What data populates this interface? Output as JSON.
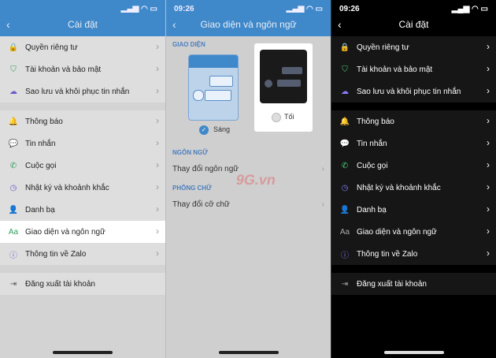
{
  "left": {
    "time": "",
    "title": "Cài đặt",
    "groups": [
      [
        {
          "label": "Quyền riêng tư",
          "icon": "lock-icon"
        },
        {
          "label": "Tài khoản và bảo mật",
          "icon": "shield-icon"
        },
        {
          "label": "Sao lưu và khôi phục tin nhắn",
          "icon": "cloud-icon"
        }
      ],
      [
        {
          "label": "Thông báo",
          "icon": "bell-icon"
        },
        {
          "label": "Tin nhắn",
          "icon": "chat-icon"
        },
        {
          "label": "Cuộc gọi",
          "icon": "phone-icon"
        },
        {
          "label": "Nhật ký và khoảnh khắc",
          "icon": "clock-icon"
        },
        {
          "label": "Danh bạ",
          "icon": "person-icon"
        },
        {
          "label": "Giao diện và ngôn ngữ",
          "icon": "aa-icon"
        },
        {
          "label": "Thông tin về Zalo",
          "icon": "info-icon"
        }
      ],
      [
        {
          "label": "Đăng xuất tài khoản",
          "icon": "logout-icon"
        }
      ]
    ]
  },
  "middle": {
    "time": "09:26",
    "title": "Giao diện và ngôn ngữ",
    "section_theme": "GIAO DIỆN",
    "light_label": "Sáng",
    "dark_label": "Tối",
    "section_lang": "NGÔN NGỮ",
    "lang_row": "Thay đổi ngôn ngữ",
    "section_font": "PHÔNG CHỮ",
    "font_row": "Thay đổi cỡ chữ",
    "watermark": "9G.vn"
  },
  "right": {
    "time": "09:26",
    "title": "Cài đặt"
  },
  "colors": {
    "accent": "#3f88c9",
    "dark_bg": "#000000",
    "light_bg": "#d3d3d3"
  }
}
